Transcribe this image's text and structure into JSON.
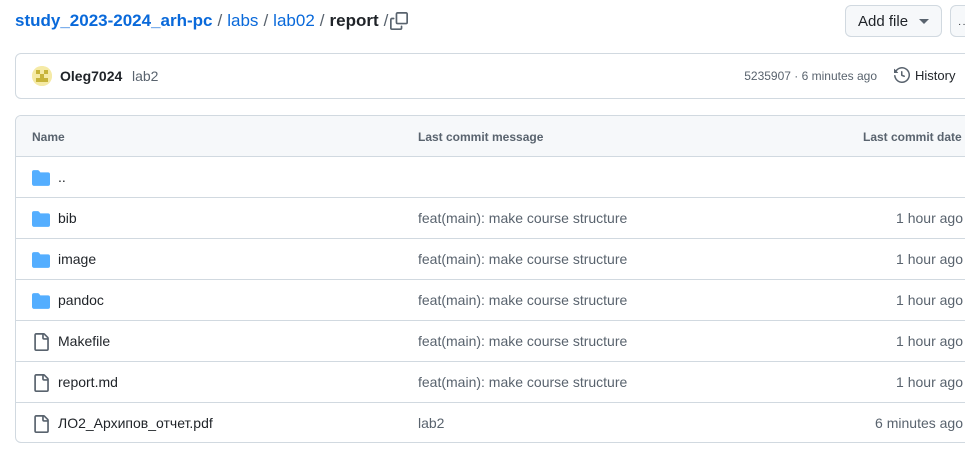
{
  "breadcrumb": {
    "repo": "study_2023-2024_arh-pc",
    "sep1": "/",
    "dir1": "labs",
    "sep2": "/",
    "dir2": "lab02",
    "sep3": "/",
    "current": "report",
    "sep4": "/"
  },
  "toolbar": {
    "add_file_label": "Add file",
    "more_label": "···"
  },
  "commit": {
    "author": "Oleg7024",
    "message": "lab2",
    "meta": "5235907 · 6 minutes ago",
    "history_label": "History"
  },
  "table": {
    "headers": {
      "name": "Name",
      "message": "Last commit message",
      "date": "Last commit date"
    },
    "rows": [
      {
        "type": "folder",
        "name": "..",
        "message": "",
        "date": ""
      },
      {
        "type": "folder",
        "name": "bib",
        "message": "feat(main): make course structure",
        "date": "1 hour ago"
      },
      {
        "type": "folder",
        "name": "image",
        "message": "feat(main): make course structure",
        "date": "1 hour ago"
      },
      {
        "type": "folder",
        "name": "pandoc",
        "message": "feat(main): make course structure",
        "date": "1 hour ago"
      },
      {
        "type": "file",
        "name": "Makefile",
        "message": "feat(main): make course structure",
        "date": "1 hour ago"
      },
      {
        "type": "file",
        "name": "report.md",
        "message": "feat(main): make course structure",
        "date": "1 hour ago"
      },
      {
        "type": "file",
        "name": "ЛО2_Архипов_отчет.pdf",
        "message": "lab2",
        "date": "6 minutes ago"
      }
    ]
  },
  "colors": {
    "link": "#0969da",
    "folder": "#54aeff",
    "muted": "#59636e",
    "border": "#d1d9e0"
  },
  "icons": {
    "folder": "folder-icon",
    "file": "file-icon",
    "copy": "copy-icon",
    "history": "history-icon",
    "caret": "triangle-down-icon"
  }
}
